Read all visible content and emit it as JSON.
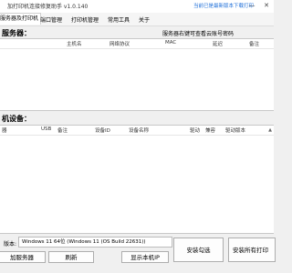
{
  "window": {
    "title": "加打印机连接修复助手 v1.0.140",
    "update_link": "当前已是最新版本下载打印",
    "minimize": "—",
    "close": "✕"
  },
  "menu": [
    "服务器及打印机",
    "端口管理",
    "打印机管理",
    "常用工具",
    "关于"
  ],
  "servers": {
    "title": "服务器：",
    "hint": "服务器右键可查看云账号密码",
    "columns": [
      "主机名",
      "网络协议",
      "MAC",
      "延迟",
      "备注"
    ]
  },
  "devices": {
    "title": "机设备：",
    "columns": [
      "器",
      "USB",
      "备注",
      "设备ID",
      "设备名称",
      "驱动",
      "兼容",
      "驱动版本"
    ]
  },
  "system": {
    "label": "版本:",
    "value": "Windows 11 64位 (Windows 11 (OS Build 22631))"
  },
  "buttons": {
    "add_server": "加服务器",
    "refresh": "刷新",
    "show_ip": "显示本机IP",
    "install_selected": "安装勾选",
    "install_all": "安装所有打印"
  }
}
